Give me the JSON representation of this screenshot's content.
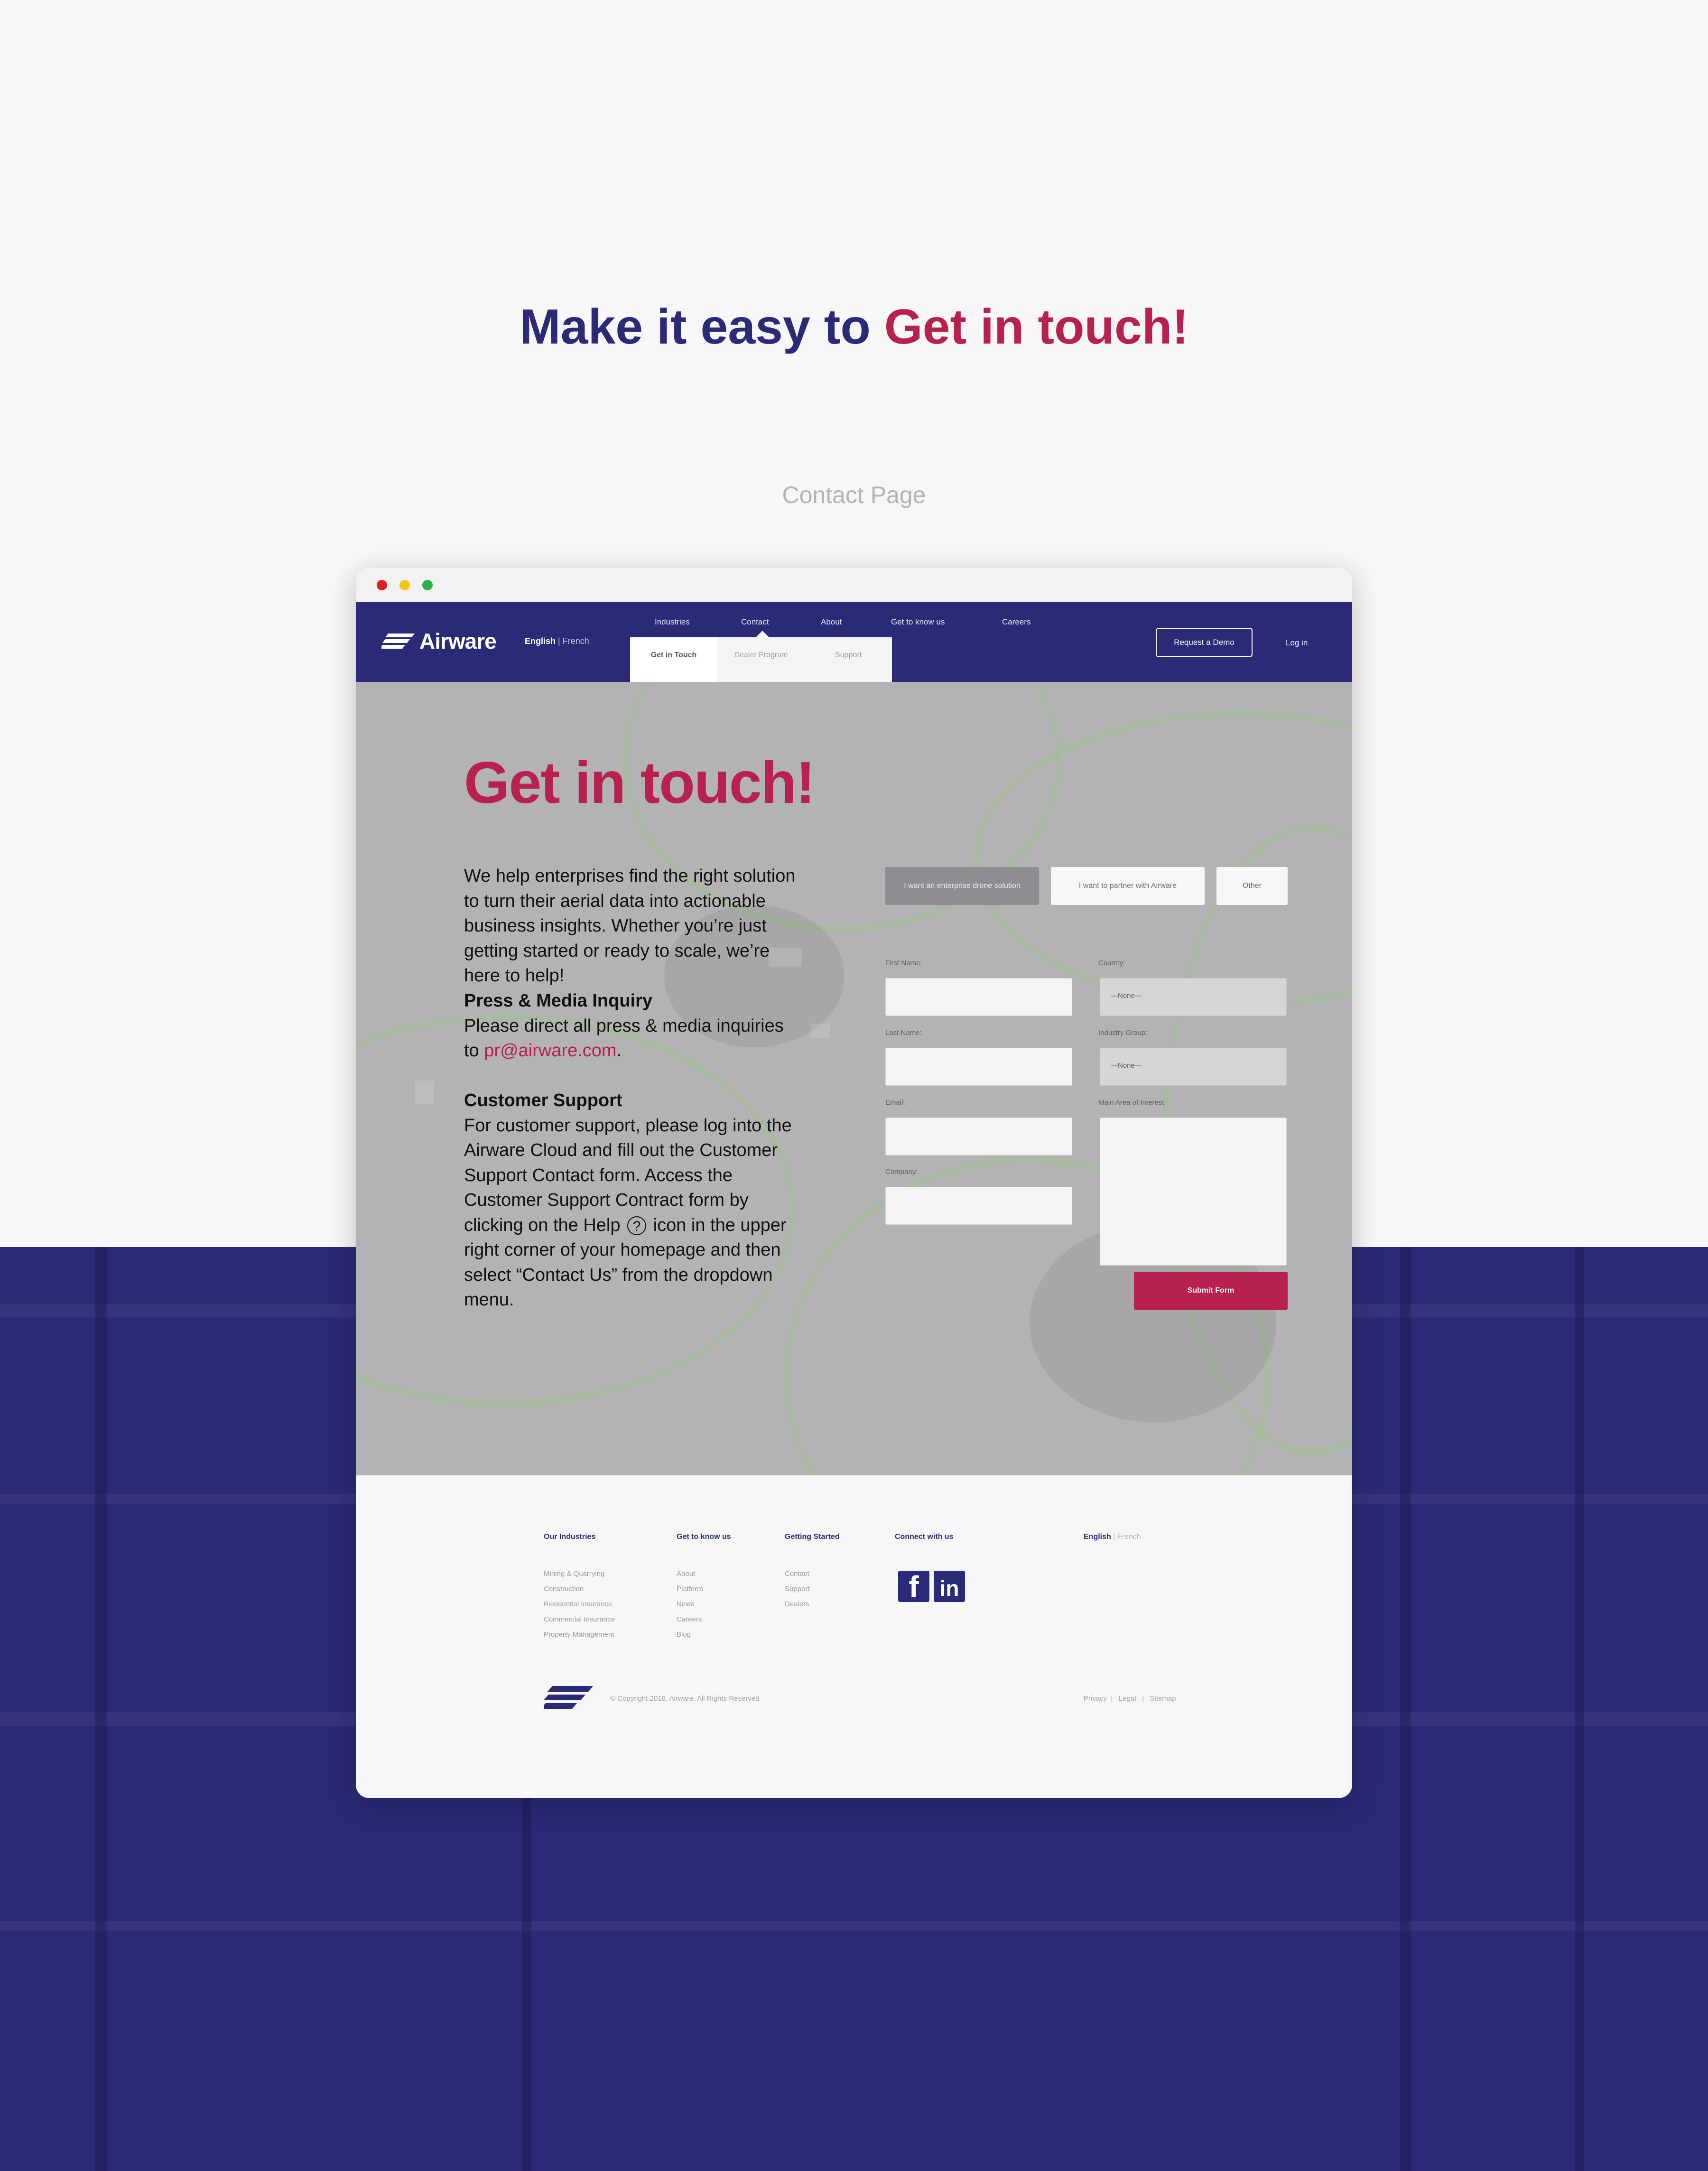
{
  "page": {
    "headline_part1": "Make it easy to",
    "headline_part2": "Get in touch!",
    "subheading": "Contact Page"
  },
  "colors": {
    "navy": "#2b2a77",
    "crimson": "#b8214d",
    "background": "#f7f7f8",
    "dot_red": "#e02020",
    "dot_yellow": "#f5c518",
    "dot_green": "#27b24a"
  },
  "nav": {
    "logo": "Airware",
    "lang_english": "English",
    "lang_separator": "|",
    "lang_french": "French",
    "items": [
      "Industries",
      "Contact",
      "About",
      "Get to know us",
      "Careers"
    ],
    "subnav": [
      "Get in Touch",
      "Dealer Program",
      "Support"
    ],
    "demo_button": "Request a Demo",
    "login": "Log in"
  },
  "hero": {
    "title": "Get in touch!",
    "intro": "We help enterprises find the right solution to turn their aerial data into actionable business insights. Whether you’re just getting started or ready to scale, we’re here to help!",
    "press_heading": "Press & Media Inquiry",
    "press_text": "Please direct all press & media inquiries to ",
    "press_email": "pr@airware.com",
    "press_end": ".",
    "support_heading": "Customer Support",
    "support_text_a": "For customer support, please log into the Airware Cloud and fill out the Customer Support Contact form. Access the Customer Support Contract form by clicking on the Help",
    "help_glyph": "?",
    "support_text_b": "icon in the upper right corner of your homepage and then select “Contact Us” from the dropdown menu."
  },
  "form": {
    "options": [
      "I want an enterprise drone solution",
      "I want to partner with Airware",
      "Other"
    ],
    "labels": {
      "first_name": "First Name:",
      "last_name": "Last Name:",
      "email": "Email:",
      "company": "Company:",
      "country": "Country:",
      "industry": "Industry Group:",
      "interest": "Main Area of Interest:"
    },
    "select_default": "—None—",
    "submit": "Submit Form"
  },
  "footer": {
    "headings": [
      "Our Industries",
      "Get to know us",
      "Getting Started",
      "Connect with us"
    ],
    "industries": [
      "Mining & Quarrying",
      "Construction",
      "Residential Insurance",
      "Commercial Insurance",
      "Property Management"
    ],
    "know": [
      "About",
      "Platform",
      "News",
      "Careers",
      "Blog"
    ],
    "started": [
      "Contact",
      "Support",
      "Dealers"
    ],
    "social": [
      "facebook-icon",
      "linkedin-icon"
    ],
    "social_text": [
      "f",
      "in"
    ],
    "lang_english": "English",
    "lang_sep": " | ",
    "lang_french": "French",
    "copyright": "© Copyright 2018, Airware. All Rights Reserved",
    "legal": [
      "Privacy",
      "Legal",
      "Sitemap"
    ]
  }
}
